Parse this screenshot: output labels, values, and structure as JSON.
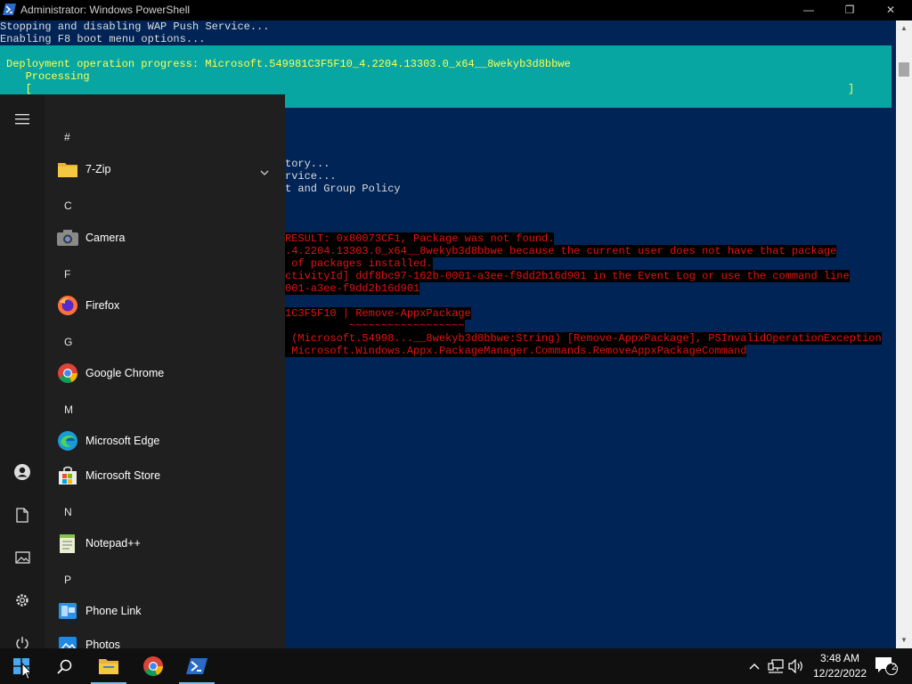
{
  "window": {
    "title": "Administrator: Windows PowerShell",
    "min_glyph": "—",
    "max_glyph": "❐",
    "close_glyph": "✕"
  },
  "console": {
    "lines": [
      "Stopping and disabling WAP Push Service...",
      "Enabling F8 boot menu options..."
    ],
    "progress": {
      "title": "Deployment operation progress: Microsoft.549981C3F5F10_4.2204.13303.0_x64__8wekyb3d8bbwe",
      "status": "   Processing",
      "bar_left": "   [",
      "bar_right": "]"
    },
    "partial_lines": [
      "tory...",
      "rvice...",
      "t and Group Policy"
    ],
    "error_lines": [
      "RESULT: 0x80073CF1, Package was not found.",
      ".4.2204.13303.0_x64__8wekyb3d8bbwe because the current user does not have that package",
      " of packages installed.",
      "ctivityId] ddf8bc97-162b-0001-a3ee-f9dd2b16d901 in the Event Log or use the command line",
      "001-a3ee-f9dd2b16d901",
      "",
      "1C3F5F10 | Remove-AppxPackage",
      "          ~~~~~~~~~~~~~~~~~~",
      " (Microsoft.54998...__8wekyb3d8bbwe:String) [Remove-AppxPackage], PSInvalidOperationException",
      " Microsoft.Windows.Appx.PackageManager.Commands.RemoveAppxPackageCommand"
    ]
  },
  "start_menu": {
    "groups": [
      {
        "letter": "#",
        "apps": [
          {
            "name": "7-Zip",
            "icon": "folder-icon",
            "expandable": true
          }
        ]
      },
      {
        "letter": "C",
        "apps": [
          {
            "name": "Camera",
            "icon": "camera-icon"
          }
        ]
      },
      {
        "letter": "F",
        "apps": [
          {
            "name": "Firefox",
            "icon": "firefox-icon"
          }
        ]
      },
      {
        "letter": "G",
        "apps": [
          {
            "name": "Google Chrome",
            "icon": "chrome-icon"
          }
        ]
      },
      {
        "letter": "M",
        "apps": [
          {
            "name": "Microsoft Edge",
            "icon": "edge-icon"
          },
          {
            "name": "Microsoft Store",
            "icon": "store-icon"
          }
        ]
      },
      {
        "letter": "N",
        "apps": [
          {
            "name": "Notepad++",
            "icon": "notepadpp-icon"
          }
        ]
      },
      {
        "letter": "P",
        "apps": [
          {
            "name": "Phone Link",
            "icon": "phone-link-icon"
          },
          {
            "name": "Photos",
            "icon": "photos-icon"
          }
        ]
      }
    ]
  },
  "clock": {
    "time": "3:48 AM",
    "date": "12/22/2022"
  },
  "notifications": {
    "count": "2"
  },
  "colors": {
    "console_bg": "#012456",
    "progress_bg": "#08a6a3",
    "progress_text": "#ffff4f",
    "error_text": "#e11313",
    "accent": "#76b9ed"
  }
}
